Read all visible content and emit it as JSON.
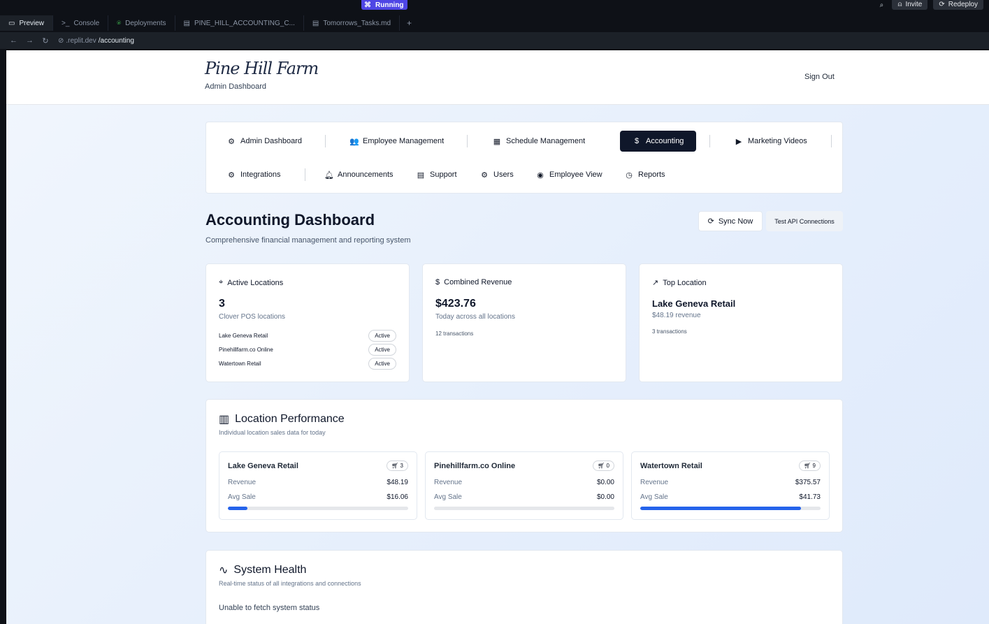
{
  "chrome": {
    "running_label": "Running",
    "invite_label": "Invite",
    "redeploy_label": "Redeploy",
    "tabs": [
      {
        "label": "Preview",
        "icon": "monitor-icon"
      },
      {
        "label": "Console",
        "icon": "terminal-icon"
      },
      {
        "label": "Deployments",
        "icon": "deployments-icon"
      },
      {
        "label": "PINE_HILL_ACCOUNTING_C...",
        "icon": "file-icon"
      },
      {
        "label": "Tomorrows_Tasks.md",
        "icon": "file-icon"
      }
    ],
    "url_host": ".replit.dev",
    "url_path": "/accounting"
  },
  "header": {
    "logo": "Pine Hill Farm",
    "subtitle": "Admin Dashboard",
    "signout": "Sign Out"
  },
  "nav": {
    "items": [
      {
        "label": "Admin Dashboard",
        "icon": "gear-icon"
      },
      {
        "label": "Employee Management",
        "icon": "users-icon"
      },
      {
        "label": "Schedule Management",
        "icon": "calendar-icon"
      },
      {
        "label": "Accounting",
        "icon": "dollar-icon"
      },
      {
        "label": "Marketing Videos",
        "icon": "video-icon"
      },
      {
        "label": "Integrations",
        "icon": "gear-icon"
      },
      {
        "label": "Announcements",
        "icon": "bell-icon"
      },
      {
        "label": "Support",
        "icon": "document-icon"
      },
      {
        "label": "Users",
        "icon": "gear-icon"
      },
      {
        "label": "Employee View",
        "icon": "eye-icon"
      },
      {
        "label": "Reports",
        "icon": "clock-icon"
      }
    ],
    "active": "Accounting"
  },
  "dashboard": {
    "title": "Accounting Dashboard",
    "subtitle": "Comprehensive financial management and reporting system",
    "sync_label": "Sync Now",
    "test_label": "Test API Connections"
  },
  "cards": {
    "active_locations": {
      "title": "Active Locations",
      "count": "3",
      "caption": "Clover POS locations",
      "locations": [
        {
          "name": "Lake Geneva Retail",
          "status": "Active"
        },
        {
          "name": "Pinehillfarm.co Online",
          "status": "Active"
        },
        {
          "name": "Watertown Retail",
          "status": "Active"
        }
      ]
    },
    "combined_revenue": {
      "title": "Combined Revenue",
      "amount": "$423.76",
      "caption": "Today across all locations",
      "transactions": "12 transactions"
    },
    "top_location": {
      "title": "Top Location",
      "name": "Lake Geneva Retail",
      "revenue": "$48.19 revenue",
      "transactions": "3 transactions"
    }
  },
  "performance": {
    "title": "Location Performance",
    "subtitle": "Individual location sales data for today",
    "revenue_label": "Revenue",
    "avg_label": "Avg Sale",
    "locations": [
      {
        "name": "Lake Geneva Retail",
        "orders": "3",
        "revenue": "$48.19",
        "avg_sale": "$16.06",
        "share": 0.11
      },
      {
        "name": "Pinehillfarm.co Online",
        "orders": "0",
        "revenue": "$0.00",
        "avg_sale": "$0.00",
        "share": 0
      },
      {
        "name": "Watertown Retail",
        "orders": "9",
        "revenue": "$375.57",
        "avg_sale": "$41.73",
        "share": 0.89
      }
    ]
  },
  "health": {
    "title": "System Health",
    "subtitle": "Real-time status of all integrations and connections",
    "message": "Unable to fetch system status"
  }
}
